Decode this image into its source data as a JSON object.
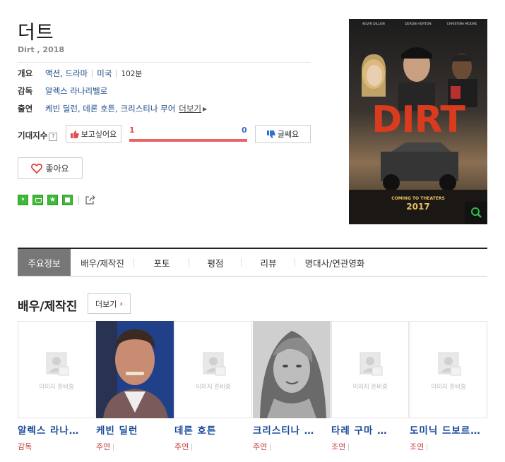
{
  "movie": {
    "title": "더트",
    "subtitle": "Dirt , 2018",
    "info": {
      "genre_label": "개요",
      "genres": [
        "액션",
        "드라마"
      ],
      "country": "미국",
      "runtime": "102분",
      "director_label": "감독",
      "director": "알렉스 라나리벨로",
      "cast_label": "출연",
      "cast_list": "케빈 딜런, 데론 호튼, 크리스티나 무어",
      "cast_more": "더보기"
    },
    "expect": {
      "label": "기대지수",
      "help": "?",
      "want_label": "보고싶어요",
      "want_count": "1",
      "dislike_count": "0",
      "dislike_label": "글쎄요"
    },
    "like_label": "좋아요",
    "share_icons": [
      "blog-icon",
      "cafe-icon",
      "bookmark-star-icon",
      "memo-icon",
      "share-icon"
    ]
  },
  "poster": {
    "actors": [
      "KEVIN DILLON",
      "DERON HORTON",
      "CHRISTINA MOORE"
    ],
    "logo": "DIRT",
    "tagline": "COMING TO THEATERS",
    "year": "2017"
  },
  "tabs": [
    "주요정보",
    "배우/제작진",
    "포토",
    "평점",
    "리뷰",
    "명대사/연관영화"
  ],
  "section": {
    "title": "배우/제작진",
    "more_label": "더보기"
  },
  "cast_cards": [
    {
      "name": "알렉스 라나…",
      "role": "감독",
      "photo": "placeholder",
      "placeholder_text": "이미지 준비중"
    },
    {
      "name": "케빈 딜런",
      "role": "주연",
      "photo": "man"
    },
    {
      "name": "데론 호튼",
      "role": "주연",
      "photo": "placeholder",
      "placeholder_text": "이미지 준비중"
    },
    {
      "name": "크리스티나 …",
      "role": "주연",
      "photo": "woman"
    },
    {
      "name": "타레 구마 …",
      "role": "조연",
      "photo": "placeholder",
      "placeholder_text": "이미지 준비중"
    },
    {
      "name": "도미닉 드보르…",
      "role": "조연",
      "photo": "placeholder",
      "placeholder_text": "이미지 준비중"
    }
  ],
  "colors": {
    "link": "#1a4a8a",
    "gauge": "#e86565",
    "role": "#c84040",
    "tab_active": "#777777"
  }
}
